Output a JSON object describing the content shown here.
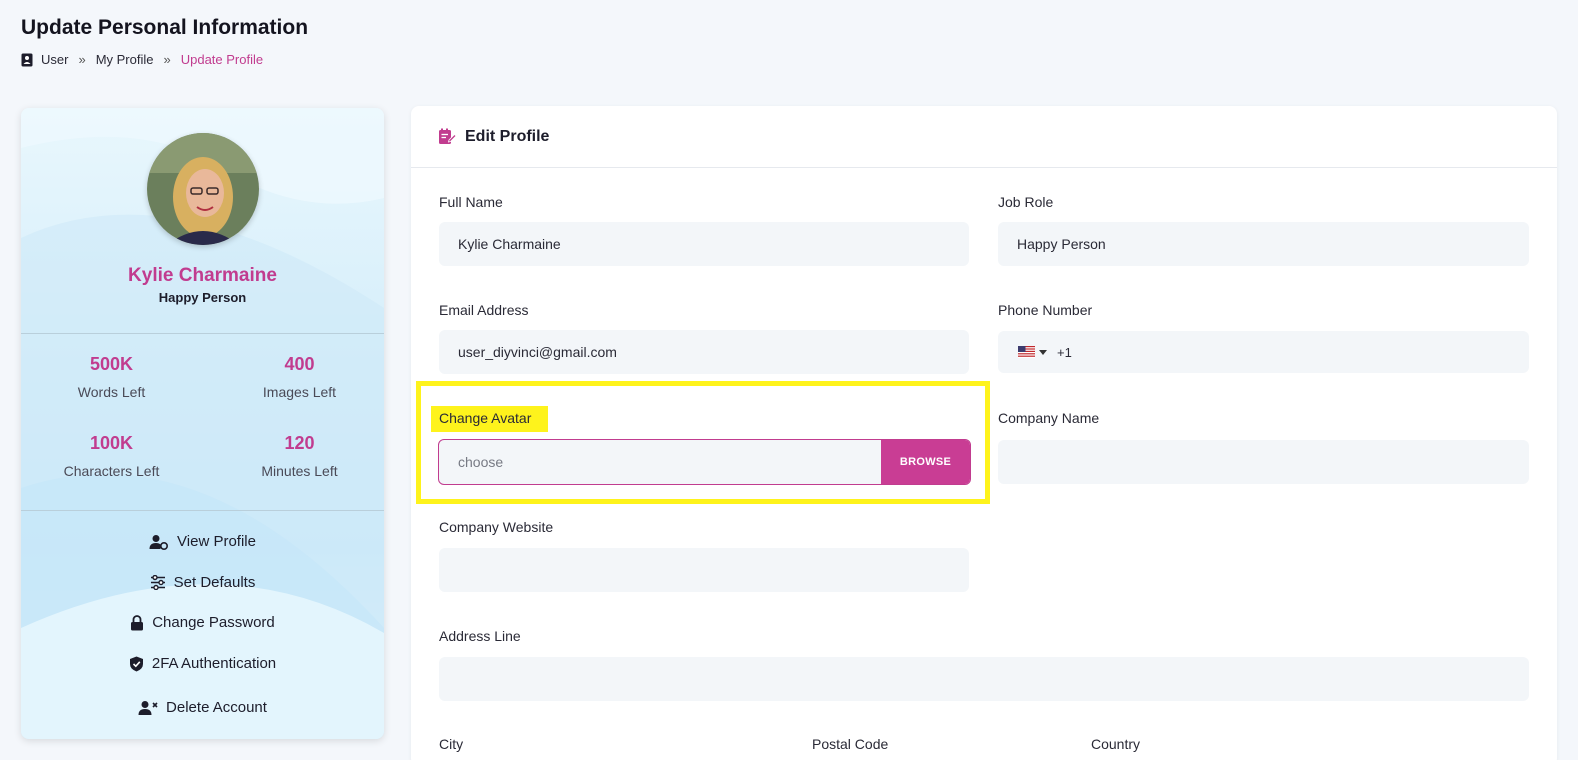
{
  "page": {
    "title": "Update Personal Information",
    "breadcrumb": [
      "User",
      "My Profile",
      "Update Profile"
    ],
    "breadcrumb_separator": "»"
  },
  "profile": {
    "name": "Kylie Charmaine",
    "role": "Happy Person",
    "stats": [
      {
        "value": "500K",
        "label": "Words Left"
      },
      {
        "value": "400",
        "label": "Images Left"
      },
      {
        "value": "100K",
        "label": "Characters Left"
      },
      {
        "value": "120",
        "label": "Minutes Left"
      }
    ],
    "menu": [
      {
        "label": "View Profile",
        "icon": "user-view-icon"
      },
      {
        "label": "Set Defaults",
        "icon": "sliders-icon"
      },
      {
        "label": "Change Password",
        "icon": "lock-icon"
      },
      {
        "label": "2FA Authentication",
        "icon": "shield-check-icon"
      },
      {
        "label": "Delete Account",
        "icon": "user-delete-icon"
      }
    ]
  },
  "edit": {
    "title": "Edit Profile",
    "full_name": {
      "label": "Full Name",
      "value": "Kylie Charmaine"
    },
    "job_role": {
      "label": "Job Role",
      "value": "Happy Person"
    },
    "email": {
      "label": "Email Address",
      "value": "user_diyvinci@gmail.com"
    },
    "phone": {
      "label": "Phone Number",
      "code": "+1"
    },
    "avatar": {
      "label": "Change Avatar",
      "placeholder": "choose",
      "button": "BROWSE"
    },
    "company_name": {
      "label": "Company Name",
      "value": ""
    },
    "company_website": {
      "label": "Company Website",
      "value": ""
    },
    "address": {
      "label": "Address Line",
      "value": ""
    },
    "city": {
      "label": "City"
    },
    "postal_code": {
      "label": "Postal Code"
    },
    "country": {
      "label": "Country"
    }
  },
  "colors": {
    "accent": "#c13c8f",
    "highlight": "#fef31c",
    "input_bg": "#f3f6f9"
  }
}
